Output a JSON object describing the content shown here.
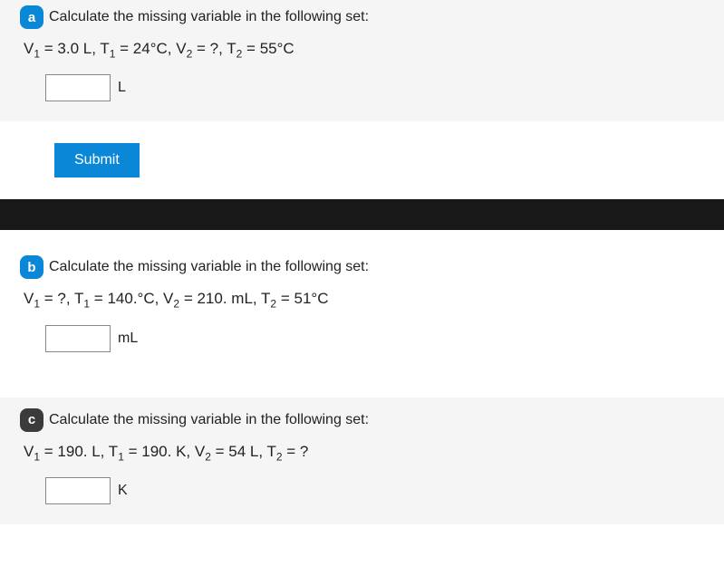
{
  "a": {
    "badge": "a",
    "prompt": "Calculate the missing variable in the following set:",
    "eq_pre": "V",
    "eq_text_parts": [
      "V",
      "1",
      " = 3.0 L, T",
      "1",
      " = 24°C, V",
      "2",
      " = ?, T",
      "2",
      " = 55°C"
    ],
    "unit": "L",
    "value": ""
  },
  "submit_label": "Submit",
  "b": {
    "badge": "b",
    "prompt": "Calculate the missing variable in the following set:",
    "eq_text_parts": [
      "V",
      "1",
      " = ?, T",
      "1",
      " = 140.°C, V",
      "2",
      " = 210. mL, T",
      "2",
      " = 51°C"
    ],
    "unit": "mL",
    "value": ""
  },
  "c": {
    "badge": "c",
    "prompt": "Calculate the missing variable in the following set:",
    "eq_text_parts": [
      "V",
      "1",
      " = 190. L, T",
      "1",
      " = 190. K, V",
      "2",
      " = 54 L, T",
      "2",
      " = ?"
    ],
    "unit": "K",
    "value": ""
  }
}
